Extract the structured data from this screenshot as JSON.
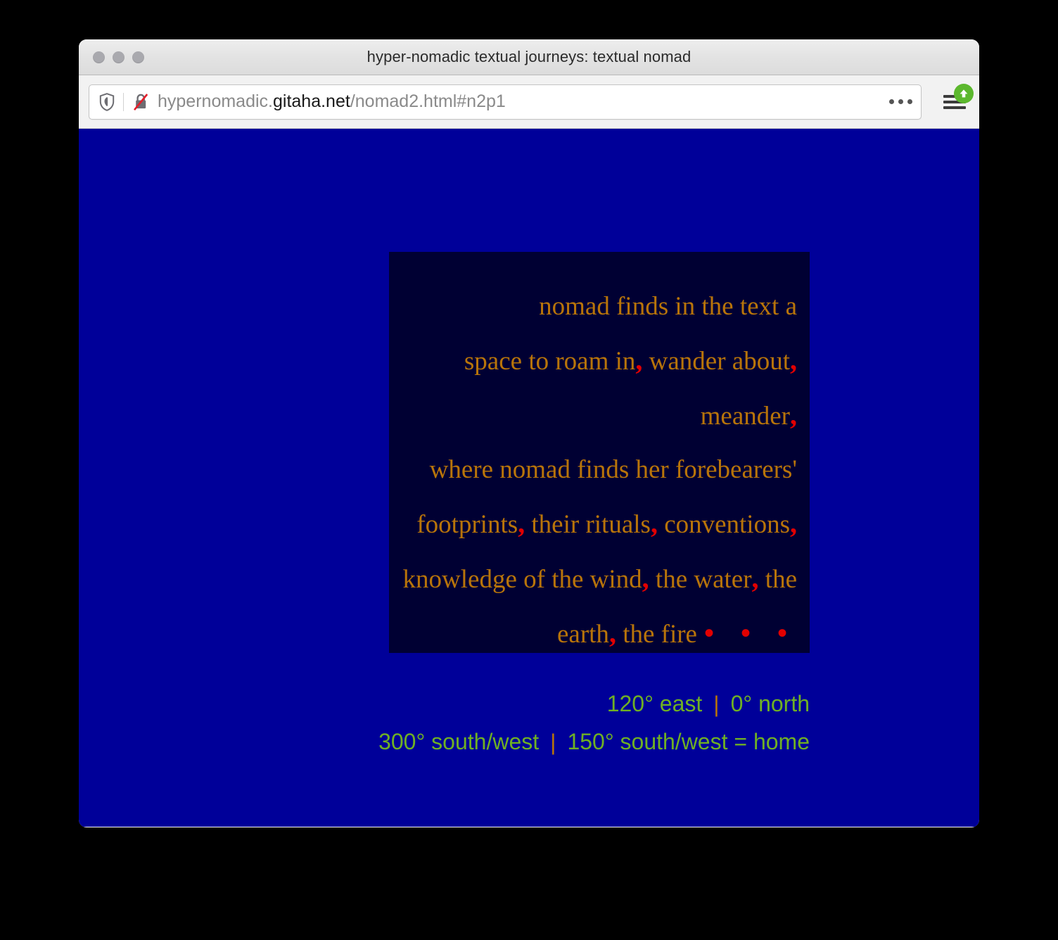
{
  "window": {
    "title": "hyper-nomadic textual journeys: textual nomad",
    "traffic_lights": [
      "close",
      "minimize",
      "zoom"
    ]
  },
  "toolbar": {
    "shield_icon": "shield-icon",
    "insecure_icon": "broken-lock-icon",
    "url": {
      "full": "hypernomadic.gitaha.net/nomad2.html#n2p1",
      "subdomain": "hypernomadic.",
      "host": "gitaha.net",
      "path": "/nomad2.html#n2p1"
    },
    "ellipsis_icon": "ellipsis-icon",
    "menu_icon": "hamburger-menu-icon",
    "update_badge_icon": "update-arrow-icon"
  },
  "page": {
    "background_color": "#000099",
    "panel_color": "#000033",
    "text_color": "#b8740a",
    "punctuation_color": "#e20000",
    "coordinate_color": "#6fb024",
    "poem": [
      {
        "text": "nomad finds in the text a",
        "punct": "",
        "tail": ""
      },
      {
        "text": "space to roam in",
        "punct": ",",
        "tail": " wander about",
        "punct2": ","
      },
      {
        "text": "meander",
        "punct": ",",
        "tail": ""
      },
      {
        "text": "where nomad finds her forebearers'",
        "punct": "",
        "tail": ""
      },
      {
        "text": "footprints",
        "punct": ",",
        "tail": " their rituals",
        "punct2": ",",
        "tail2": " conventions",
        "punct3": ","
      },
      {
        "text": "knowledge of the wind",
        "punct": ",",
        "tail": " the water",
        "punct2": ",",
        "tail2": " the"
      },
      {
        "text": "earth",
        "punct": ",",
        "tail": " the fire",
        "ellipsis": "• • •"
      }
    ],
    "coordinates": [
      {
        "left": "120° east",
        "sep": "|",
        "right": "0° north"
      },
      {
        "left": "300° south/west",
        "sep": "|",
        "right": "150° south/west = home"
      }
    ]
  }
}
